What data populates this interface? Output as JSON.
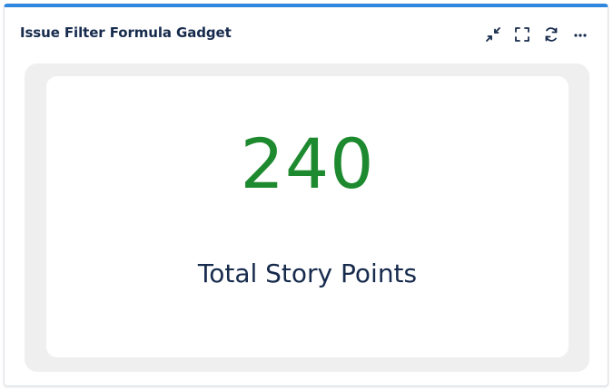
{
  "gadget": {
    "title": "Issue Filter Formula Gadget",
    "actions": [
      {
        "name": "minimize",
        "icon": "minimize-icon"
      },
      {
        "name": "fullscreen",
        "icon": "fullscreen-icon"
      },
      {
        "name": "refresh",
        "icon": "refresh-icon"
      },
      {
        "name": "more",
        "icon": "more-icon"
      }
    ],
    "result": {
      "value": "240",
      "label": "Total Story Points"
    },
    "colors": {
      "accent": "#2e86de",
      "value": "#1e8a2f",
      "text": "#172b4d",
      "panel": "#efefef"
    }
  }
}
